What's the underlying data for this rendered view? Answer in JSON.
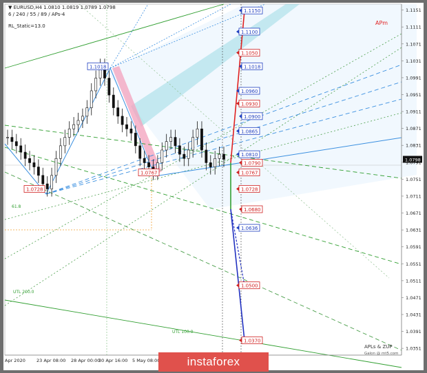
{
  "header": {
    "symbol_line": "▼ EURUSD,H4  1.0810 1.0819 1.0789 1.0798",
    "indicator_line": "6 / 240 / 55 / 89 / APs-4",
    "static_line": "RL_Static=13.0"
  },
  "branding": {
    "tag": "APm",
    "credit_line1": "APLs & ZUP",
    "credit_line2": "Galon @ mt5.com",
    "watermark": "instaforex"
  },
  "colors": {
    "background": "#ffffff",
    "grid": "#cfcfcf",
    "blue_line": "#3a8fe0",
    "green_line": "#2f9e2f",
    "red_target": "#e02020",
    "pink_zone": "#f4a6c0",
    "teal_zone": "#7fd3d8",
    "watermark_bg": "#e0514c"
  },
  "chart_data": {
    "type": "candlestick",
    "title": "EURUSD,H4",
    "ylim": [
      1.0335,
      1.1165
    ],
    "y_ticks": [
      "1.1151",
      "1.1111",
      "1.1071",
      "1.1031",
      "1.0991",
      "1.0951",
      "1.0911",
      "1.0871",
      "1.0831",
      "1.0791",
      "1.0751",
      "1.0711",
      "1.0671",
      "1.0631",
      "1.0591",
      "1.0551",
      "1.0511",
      "1.0471",
      "1.0431",
      "1.0391",
      "1.0351"
    ],
    "x_ticks": [
      "Apr 2020",
      "23 Apr 08:00",
      "28 Apr 00:00",
      "30 Apr 16:00",
      "5 May 08:00"
    ],
    "current_price": "1.0798",
    "close_series": [
      1.085,
      1.084,
      1.083,
      1.0815,
      1.08,
      1.079,
      1.078,
      1.076,
      1.074,
      1.0728,
      1.076,
      1.08,
      1.083,
      1.085,
      1.087,
      1.088,
      1.089,
      1.09,
      1.092,
      1.096,
      1.099,
      1.1018,
      1.099,
      1.095,
      1.092,
      1.09,
      1.088,
      1.087,
      1.086,
      1.083,
      1.08,
      1.079,
      1.078,
      1.0767,
      1.079,
      1.082,
      1.084,
      1.085,
      1.083,
      1.081,
      1.08,
      1.082,
      1.085,
      1.087,
      1.082,
      1.079,
      1.078,
      1.08,
      1.081,
      1.0798
    ],
    "pivot_labels": [
      "1.1018",
      "1.0767",
      "1.0728"
    ],
    "target_labels": [
      {
        "price": 1.115,
        "label": "1.1150",
        "color": "blue"
      },
      {
        "price": 1.11,
        "label": "1.1100",
        "color": "blue"
      },
      {
        "price": 1.105,
        "label": "1.1050",
        "color": "red"
      },
      {
        "price": 1.1018,
        "label": "1.1018",
        "color": "blue"
      },
      {
        "price": 1.096,
        "label": "1.0960",
        "color": "blue"
      },
      {
        "price": 1.093,
        "label": "1.0930",
        "color": "red"
      },
      {
        "price": 1.09,
        "label": "1.0900",
        "color": "blue"
      },
      {
        "price": 1.0865,
        "label": "1.0865",
        "color": "blue"
      },
      {
        "price": 1.081,
        "label": "1.0810",
        "color": "blue"
      },
      {
        "price": 1.079,
        "label": "1.0790",
        "color": "red"
      },
      {
        "price": 1.0767,
        "label": "1.0767",
        "color": "red"
      },
      {
        "price": 1.0728,
        "label": "1.0728",
        "color": "red"
      },
      {
        "price": 1.068,
        "label": "1.0680",
        "color": "red"
      },
      {
        "price": 1.0636,
        "label": "1.0636",
        "color": "blue"
      },
      {
        "price": 1.05,
        "label": "1.0500",
        "color": "red"
      },
      {
        "price": 1.037,
        "label": "1.0370",
        "color": "red"
      }
    ],
    "fan_labels": [
      "UTL 200.0",
      "UTL 100.0",
      "61.8"
    ]
  }
}
